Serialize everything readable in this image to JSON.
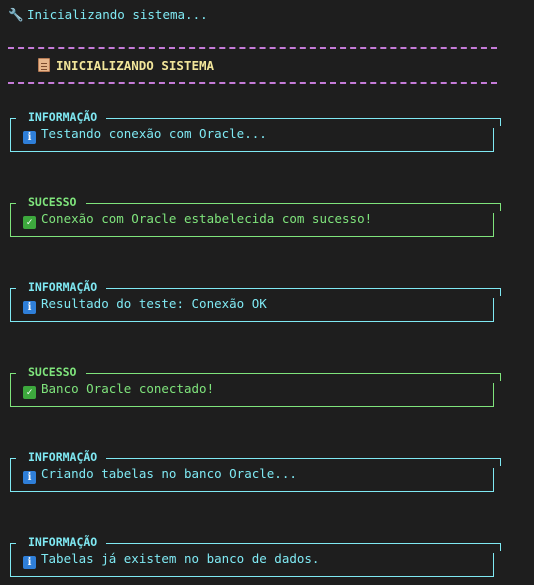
{
  "init": {
    "icon": "wrench-icon",
    "text": "Inicializando sistema..."
  },
  "header": {
    "icon": "clipboard-icon",
    "title": "INICIALIZANDO SISTEMA"
  },
  "colors": {
    "background": "#1e1e1e",
    "info": "#7fe9f3",
    "success": "#7fe47c",
    "divider": "#c57bd8",
    "header_title": "#f1e59a"
  },
  "messages": [
    {
      "type": "info",
      "label": "INFORMAÇÃO",
      "icon": "info-icon",
      "text": "Testando conexão com Oracle..."
    },
    {
      "type": "success",
      "label": "SUCESSO",
      "icon": "check-icon",
      "text": "Conexão com Oracle estabelecida com sucesso!"
    },
    {
      "type": "info",
      "label": "INFORMAÇÃO",
      "icon": "info-icon",
      "text": "Resultado do teste: Conexão OK"
    },
    {
      "type": "success",
      "label": "SUCESSO",
      "icon": "check-icon",
      "text": "Banco Oracle conectado!"
    },
    {
      "type": "info",
      "label": "INFORMAÇÃO",
      "icon": "info-icon",
      "text": "Criando tabelas no banco Oracle..."
    },
    {
      "type": "info",
      "label": "INFORMAÇÃO",
      "icon": "info-icon",
      "text": "Tabelas já existem no banco de dados."
    }
  ]
}
